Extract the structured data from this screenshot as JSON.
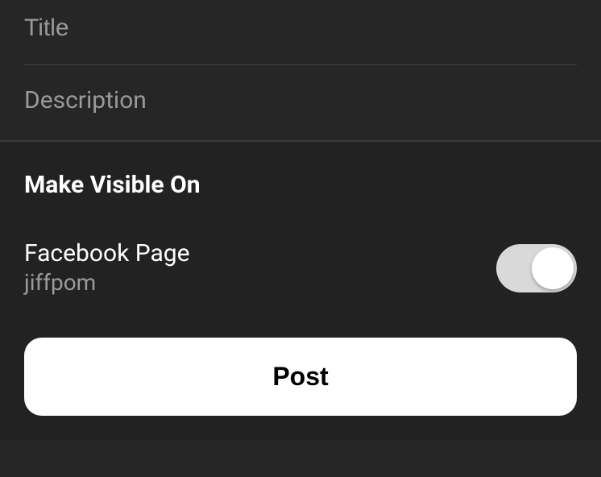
{
  "inputs": {
    "title_placeholder": "Title",
    "title_value": "",
    "description_placeholder": "Description",
    "description_value": ""
  },
  "visible": {
    "heading": "Make Visible On",
    "facebook": {
      "label": "Facebook Page",
      "subtitle": "jiffpom",
      "enabled": true
    }
  },
  "actions": {
    "post_label": "Post"
  }
}
